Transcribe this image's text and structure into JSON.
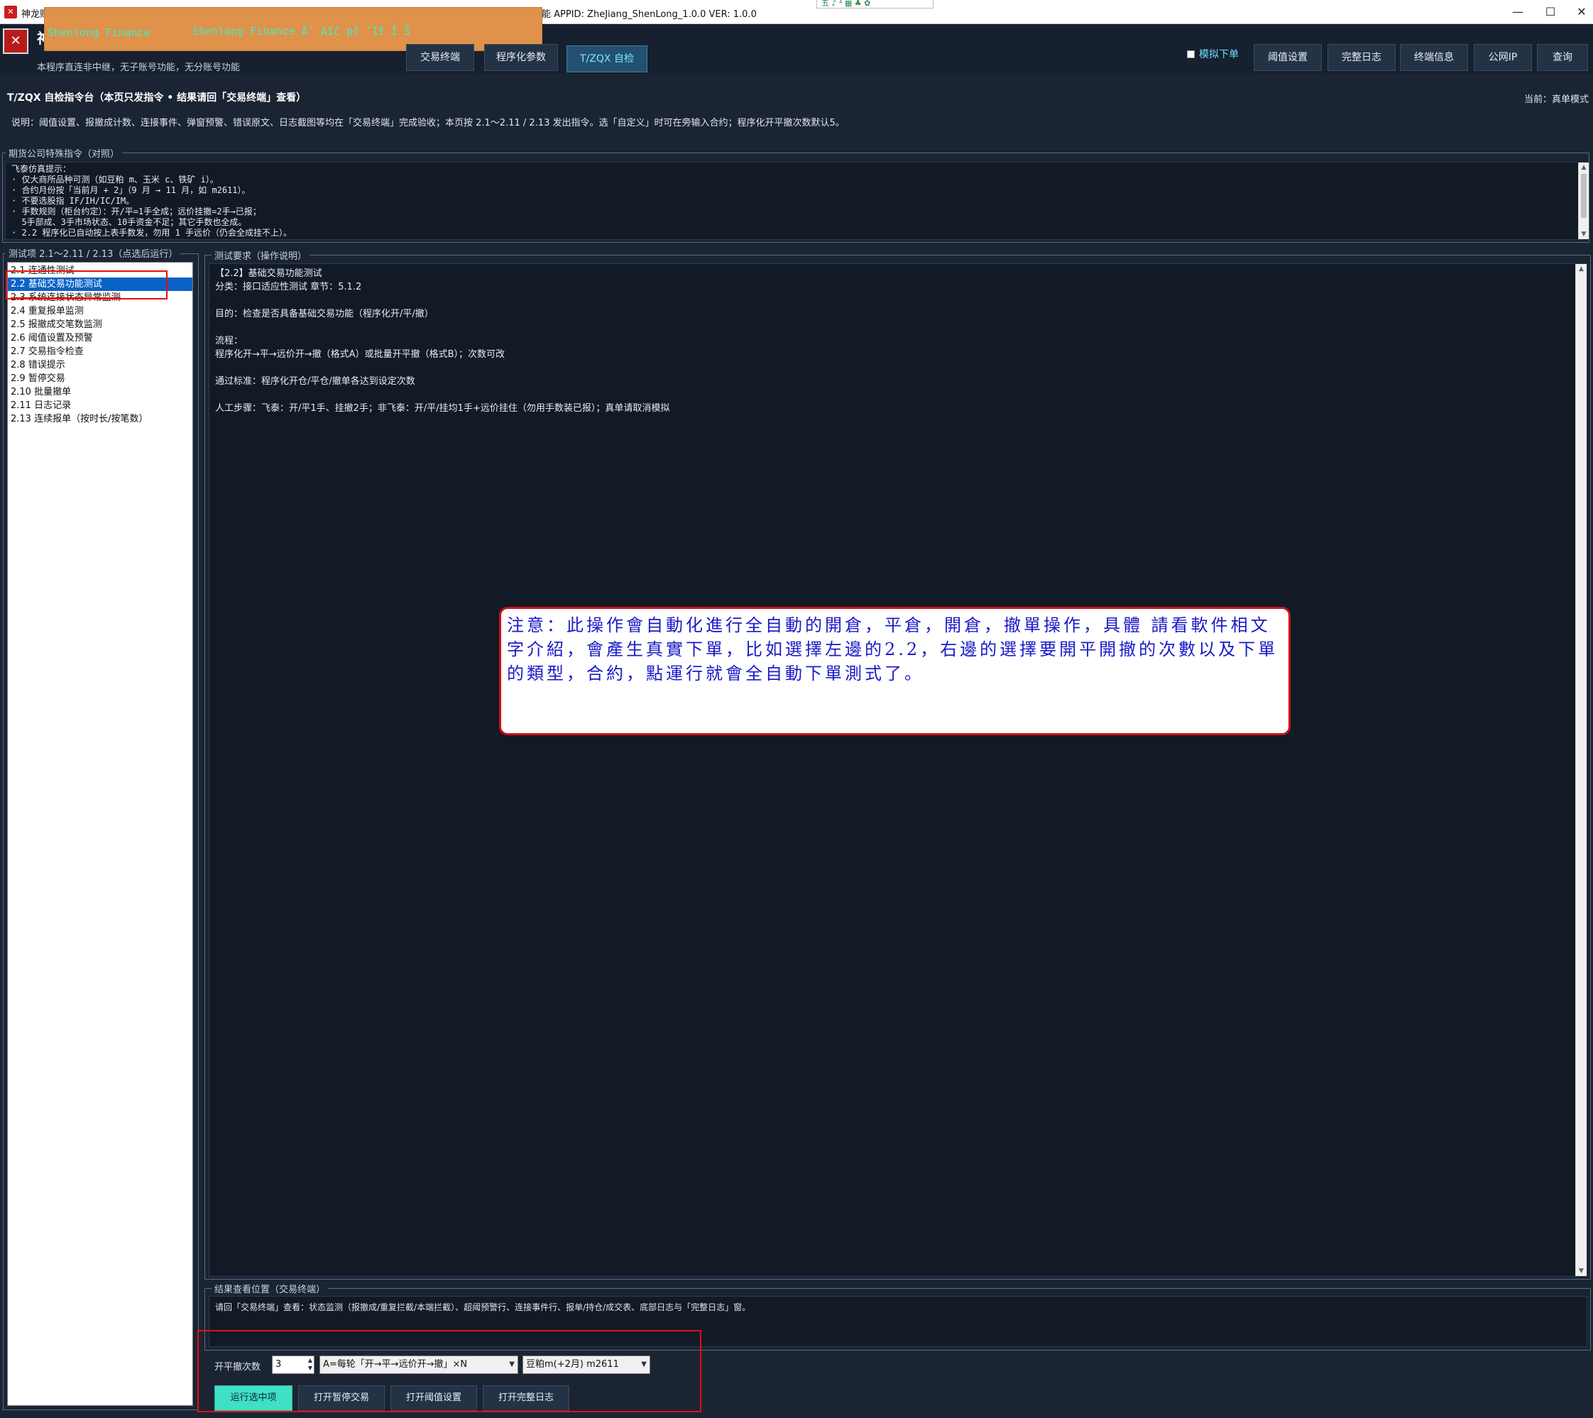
{
  "window": {
    "title": "神龙财",
    "appid_text": "功能 APPID:  ZheJiang_ShenLong_1.0.0  VER:  1.0.0",
    "ime_text": "五 ♪ ⁴ ▦ ♣ ✿"
  },
  "header": {
    "title": "神",
    "desc": "本程序直连非中继，无子账号功能，无分账号功能",
    "overlay_text_1": "Shenlong Finance",
    "overlay_text_2": "Shenlong Finance Ã˜ AIć pč ˜Iť Ì Š"
  },
  "nav_tabs": [
    {
      "label": "交易终端"
    },
    {
      "label": "程序化参数"
    },
    {
      "label": "T/ZQX 自检"
    }
  ],
  "sim_label": "模拟下单",
  "top_buttons": [
    {
      "label": "阈值设置"
    },
    {
      "label": "完整日志"
    },
    {
      "label": "终端信息"
    },
    {
      "label": "公网IP"
    },
    {
      "label": "查询"
    }
  ],
  "cmd": {
    "title": "T/ZQX 自检指令台（本页只发指令 • 结果请回「交易终端」查看）",
    "current_mode": "当前：真单模式",
    "desc": "说明：阈值设置、报撤成计数、连接事件、弹窗预警、错误原文、日志截图等均在「交易终端」完成验收；本页按 2.1～2.11 / 2.13 发出指令。选「自定义」时可在旁输入合约；程序化开平撤次数默认5。"
  },
  "notice": {
    "label": "期货公司特殊指令（对照）",
    "lines": [
      "飞泰仿真提示：",
      "· 仅大商所品种可测（如豆粕 m、玉米 c、铁矿 i）。",
      "· 合约月份按「当前月 + 2」（9 月 → 11 月，如 m2611）。",
      "· 不要选股指 IF/IH/IC/IM。",
      "· 手数规则（柜台约定）：开/平=1手全成；远价挂撤=2手→已报；",
      "  5手部成、3手市场状态、10手资金不足；其它手数也全成。",
      "· 2.2 程序化已自动按上表手数发，勿用 1 手远价（仍会全成挂不上）。"
    ]
  },
  "test_list": {
    "label": "测试项 2.1～2.11 / 2.13（点选后运行）",
    "items": [
      {
        "label": "2.1  连通性测试"
      },
      {
        "label": "2.2  基础交易功能测试"
      },
      {
        "label": "2.3  系统连接状态异常监测"
      },
      {
        "label": "2.4  重复报单监测"
      },
      {
        "label": "2.5  报撤成交笔数监测"
      },
      {
        "label": "2.6  阈值设置及预警"
      },
      {
        "label": "2.7  交易指令检查"
      },
      {
        "label": "2.8  错误提示"
      },
      {
        "label": "2.9  暂停交易"
      },
      {
        "label": "2.10  批量撤单"
      },
      {
        "label": "2.11  日志记录"
      },
      {
        "label": "2.13  连续报单（按时长/按笔数）"
      }
    ]
  },
  "requirement": {
    "label": "测试要求（操作说明）",
    "lines": [
      "【2.2】基础交易功能测试",
      "分类：接口适应性测试  章节：5.1.2",
      "",
      "目的：检查是否具备基础交易功能（程序化开/平/撤）",
      "",
      "流程：",
      "程序化开→平→远价开→撤（格式A）或批量开平撤（格式B）；次数可改",
      "",
      "通过标准：程序化开仓/平仓/撤单各达到设定次数",
      "",
      "人工步骤：飞泰：开/平1手、挂撤2手；非飞泰：开/平/挂均1手+远价挂住（勿用手数装已报）；真单请取消模拟"
    ]
  },
  "callout_text": "注意：此操作會自動化進行全自動的開倉，平倉，開倉，撤單操作，具體 請看軟件相文字介紹，會產生真實下單，比如選擇左邊的2.2，右邊的選擇要開平開撤的次數以及下單的類型，合約，點運行就會全自動下單測式了。",
  "result": {
    "label": "结果查看位置（交易终端）",
    "text": "请回「交易终端」查看：状态监测（报撤成/重复拦截/本端拦截）、超阈预警行、连接事件行、报单/持仓/成交表、底部日志与「完整日志」窗。"
  },
  "controls": {
    "count_label": "开平撤次数",
    "count_value": "3",
    "mode_value": "A=每轮「开→平→远价开→撤」×N",
    "contract_value": "豆粕m(+2月) m2611"
  },
  "bottom_buttons": [
    {
      "label": "运行选中项"
    },
    {
      "label": "打开暂停交易"
    },
    {
      "label": "打开阈值设置"
    },
    {
      "label": "打开完整日志"
    }
  ]
}
